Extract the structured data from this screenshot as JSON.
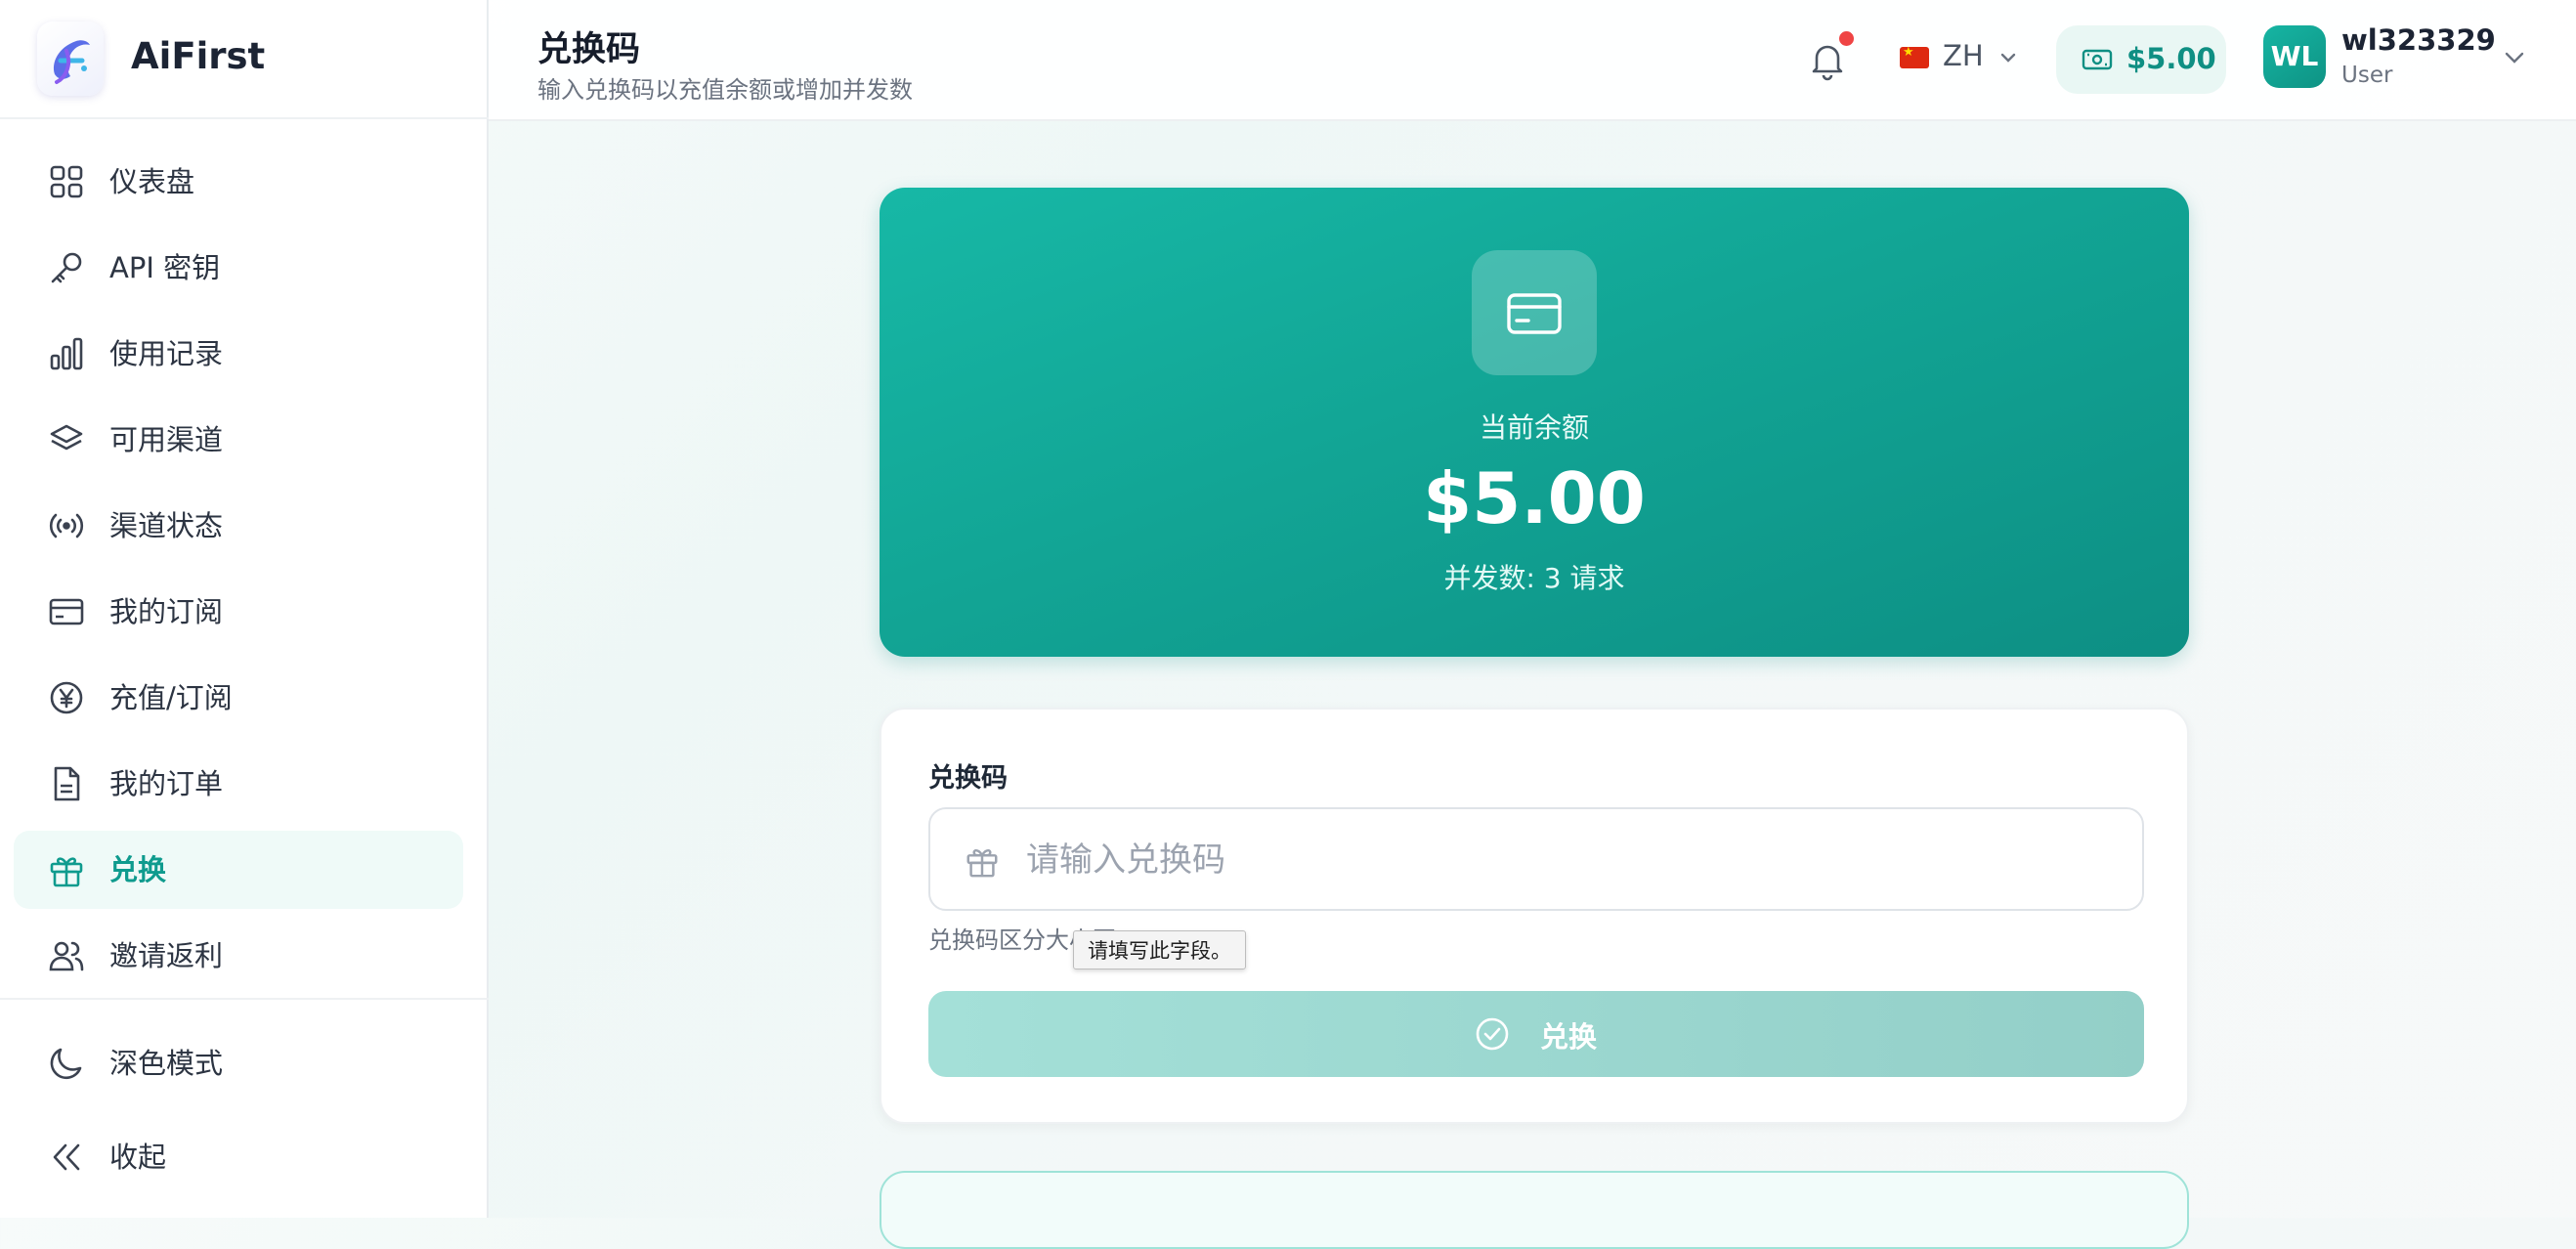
{
  "brand": {
    "name": "AiFirst"
  },
  "sidebar": {
    "items": [
      {
        "label": "仪表盘",
        "icon": "dashboard-grid-icon"
      },
      {
        "label": "API 密钥",
        "icon": "key-icon"
      },
      {
        "label": "使用记录",
        "icon": "bar-chart-icon"
      },
      {
        "label": "可用渠道",
        "icon": "layers-icon"
      },
      {
        "label": "渠道状态",
        "icon": "signal-icon"
      },
      {
        "label": "我的订阅",
        "icon": "credit-card-icon"
      },
      {
        "label": "充值/订阅",
        "icon": "yen-coin-icon"
      },
      {
        "label": "我的订单",
        "icon": "document-icon"
      },
      {
        "label": "兑换",
        "icon": "gift-icon",
        "active": true
      },
      {
        "label": "邀请返利",
        "icon": "users-icon"
      }
    ],
    "footer": [
      {
        "label": "深色模式",
        "icon": "moon-icon"
      },
      {
        "label": "收起",
        "icon": "double-chevron-left-icon"
      }
    ]
  },
  "header": {
    "title": "兑换码",
    "subtitle": "输入兑换码以充值余额或增加并发数",
    "lang": "ZH",
    "balance": "$5.00",
    "user": {
      "initials": "WL",
      "name": "wl323329",
      "role": "User"
    },
    "notification_dot": true
  },
  "balance_card": {
    "label": "当前余额",
    "amount": "$5.00",
    "concurrency": "并发数: 3 请求"
  },
  "redeem": {
    "field_label": "兑换码",
    "placeholder": "请输入兑换码",
    "value": "",
    "hint": "兑换码区分大小写",
    "tooltip": "请填写此字段。",
    "button_label": "兑换"
  },
  "colors": {
    "accent": "#12a595",
    "accent_dark": "#0d8f84",
    "active_bg": "#effaf8",
    "notify": "#ef4444"
  }
}
